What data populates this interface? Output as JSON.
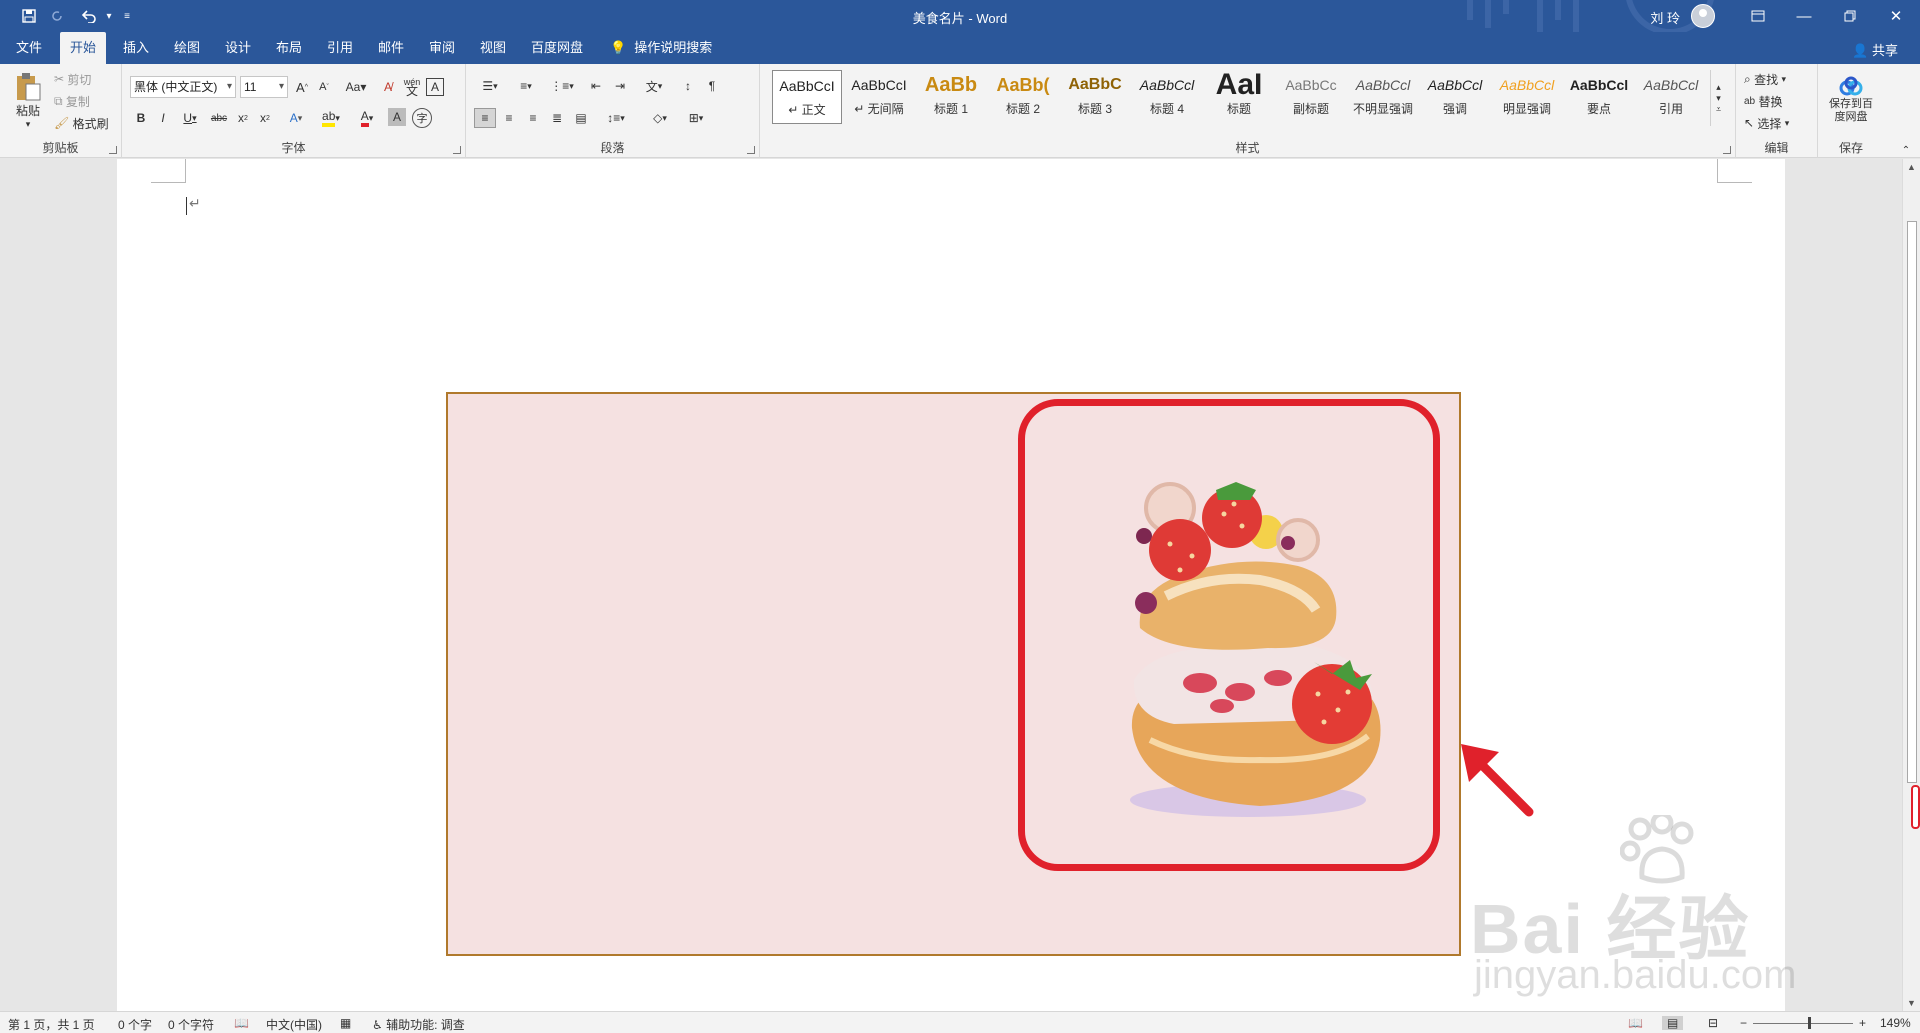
{
  "title_bar": {
    "document_title": "美食名片 - Word",
    "user_name": "刘 玲",
    "quick_access": [
      "save-icon",
      "redo-icon",
      "undo-icon",
      "customize-icon"
    ],
    "window_buttons": [
      "ribbon-display-icon",
      "minimize-icon",
      "restore-icon",
      "close-icon"
    ]
  },
  "tabs": [
    "文件",
    "开始",
    "插入",
    "绘图",
    "设计",
    "布局",
    "引用",
    "邮件",
    "审阅",
    "视图",
    "百度网盘"
  ],
  "active_tab": "开始",
  "tell_me": "操作说明搜索",
  "share_label": "共享",
  "clipboard": {
    "paste": "粘贴",
    "cut": "剪切",
    "copy": "复制",
    "format_painter": "格式刷",
    "group_label": "剪贴板"
  },
  "font": {
    "font_name": "黑体 (中文正文)",
    "font_size": "11",
    "group_label": "字体"
  },
  "paragraph": {
    "group_label": "段落"
  },
  "styles": {
    "items": [
      {
        "sample": "AaBbCcI",
        "label": "↵ 正文"
      },
      {
        "sample": "AaBbCcI",
        "label": "↵ 无间隔"
      },
      {
        "sample": "AaBb",
        "label": "标题 1"
      },
      {
        "sample": "AaBb(",
        "label": "标题 2"
      },
      {
        "sample": "AaBbC",
        "label": "标题 3"
      },
      {
        "sample": "AaBbCcl",
        "label": "标题 4"
      },
      {
        "sample": "AaI",
        "label": "标题"
      },
      {
        "sample": "AaBbCc",
        "label": "副标题"
      },
      {
        "sample": "AaBbCcl",
        "label": "不明显强调"
      },
      {
        "sample": "AaBbCcl",
        "label": "强调"
      },
      {
        "sample": "AaBbCcl",
        "label": "明显强调"
      },
      {
        "sample": "AaBbCcl",
        "label": "要点"
      },
      {
        "sample": "AaBbCcl",
        "label": "引用"
      }
    ],
    "group_label": "样式"
  },
  "editing": {
    "find": "查找",
    "replace": "替换",
    "select": "选择",
    "group_label": "编辑"
  },
  "save_group": {
    "button": "保存到百度网盘",
    "group_label": "保存"
  },
  "watermark": {
    "brand": "Bai 经验",
    "url": "jingyan.baidu.com"
  },
  "status_bar": {
    "page": "第 1 页，共 1 页",
    "words": "0 个字",
    "chars": "0 个字符",
    "language": "中文(中国)",
    "accessibility": "辅助功能: 调查",
    "zoom": "149%"
  },
  "colors": {
    "title_bar": "#2b579a",
    "card_background": "#f5e1e1",
    "card_border": "#b0792c",
    "highlight": "#e0212b"
  }
}
